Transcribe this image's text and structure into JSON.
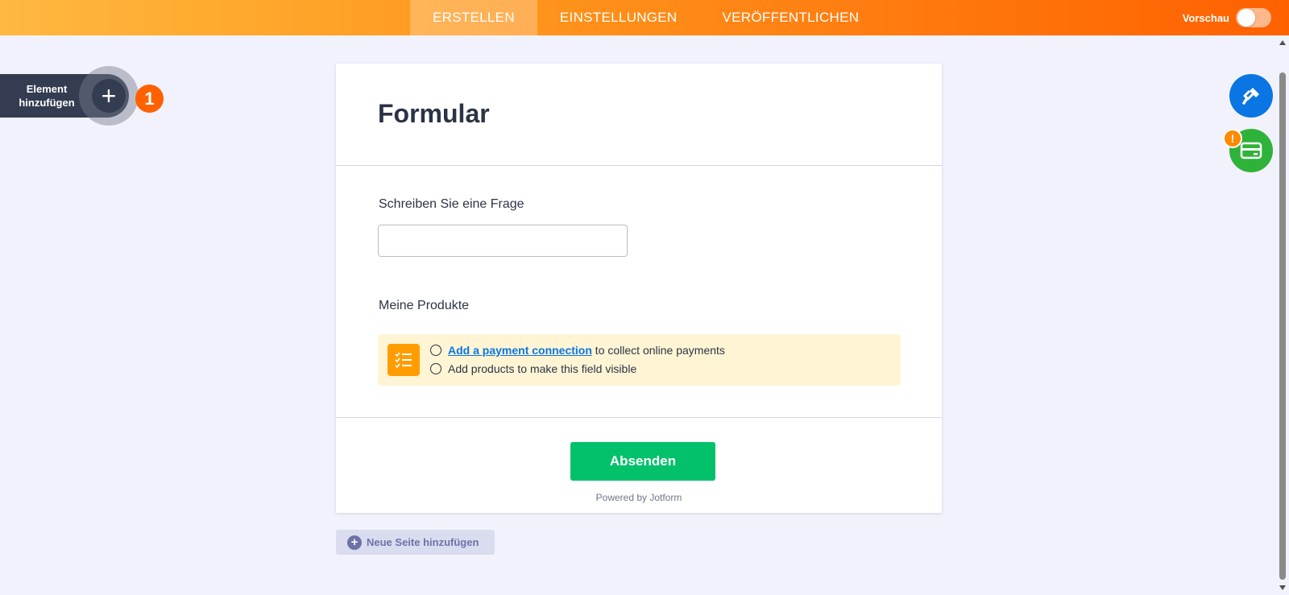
{
  "nav": {
    "tabs": [
      {
        "label": "ERSTELLEN",
        "active": true
      },
      {
        "label": "EINSTELLUNGEN",
        "active": false
      },
      {
        "label": "VERÖFFENTLICHEN",
        "active": false
      }
    ],
    "preview_label": "Vorschau",
    "preview_on": false
  },
  "left": {
    "add_element_label": "Element\nhinzufügen",
    "plus": "+",
    "step_number": "1"
  },
  "right": {
    "alert_badge": "!"
  },
  "form": {
    "title": "Formular",
    "question_label": "Schreiben Sie eine Frage",
    "question_value": "",
    "products_label": "Meine Produkte",
    "notice": {
      "link_text": "Add a payment connection",
      "row1_rest": " to collect online payments",
      "row2": "Add products to make this field visible"
    },
    "submit_label": "Absenden",
    "powered_by": "Powered by Jotform"
  },
  "add_page_label": "Neue Seite hinzufügen",
  "colors": {
    "accent_orange": "#ff6100",
    "submit_green": "#02c16a",
    "link_blue": "#0a75e3"
  }
}
